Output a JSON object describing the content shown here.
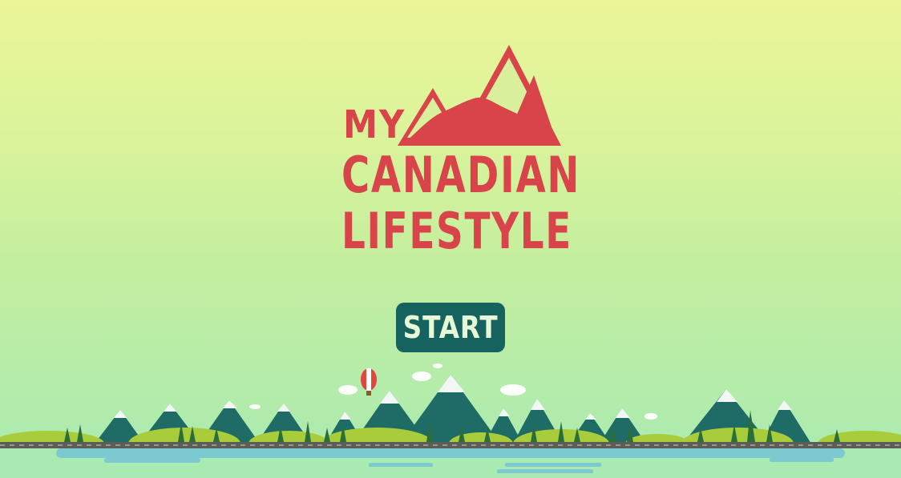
{
  "logo": {
    "line1": "MY",
    "line2": "CANADIAN",
    "line3": "LIFESTYLE",
    "color": "#d9434a"
  },
  "start_button": {
    "label": "START",
    "background": "#16625e",
    "text_color": "#e6f8d6"
  },
  "scenery": {
    "sky_top": "#ecf598",
    "sky_bottom": "#a9eab2",
    "mountain_color": "#1f6b66",
    "snow_color": "#f2f6f4",
    "hill_color": "#a8cc3a",
    "tree_color": "#2a6f3a",
    "road_color": "#5d5d58",
    "water_color": "#7ccacf",
    "balloon_color": "#e0463e",
    "cloud_color": "#ffffff"
  }
}
